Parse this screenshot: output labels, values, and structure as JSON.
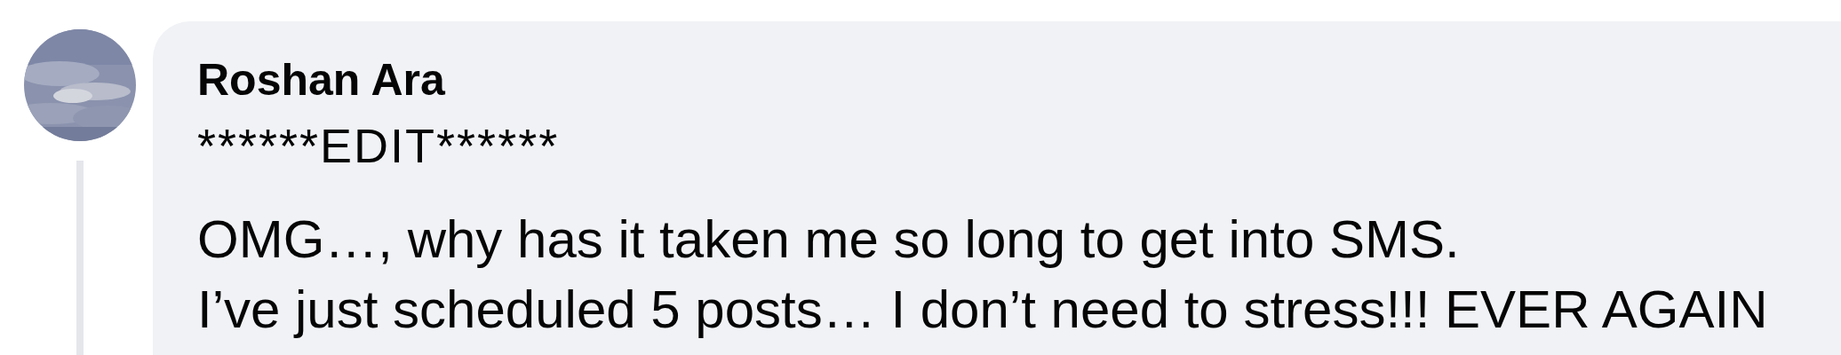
{
  "comment": {
    "author": "Roshan Ara",
    "paragraphs": [
      "******EDIT******",
      "OMG…, why has it taken me so long to get into SMS.\nI’ve just scheduled 5 posts… I don’t need to stress!!! EVER AGAIN"
    ]
  }
}
